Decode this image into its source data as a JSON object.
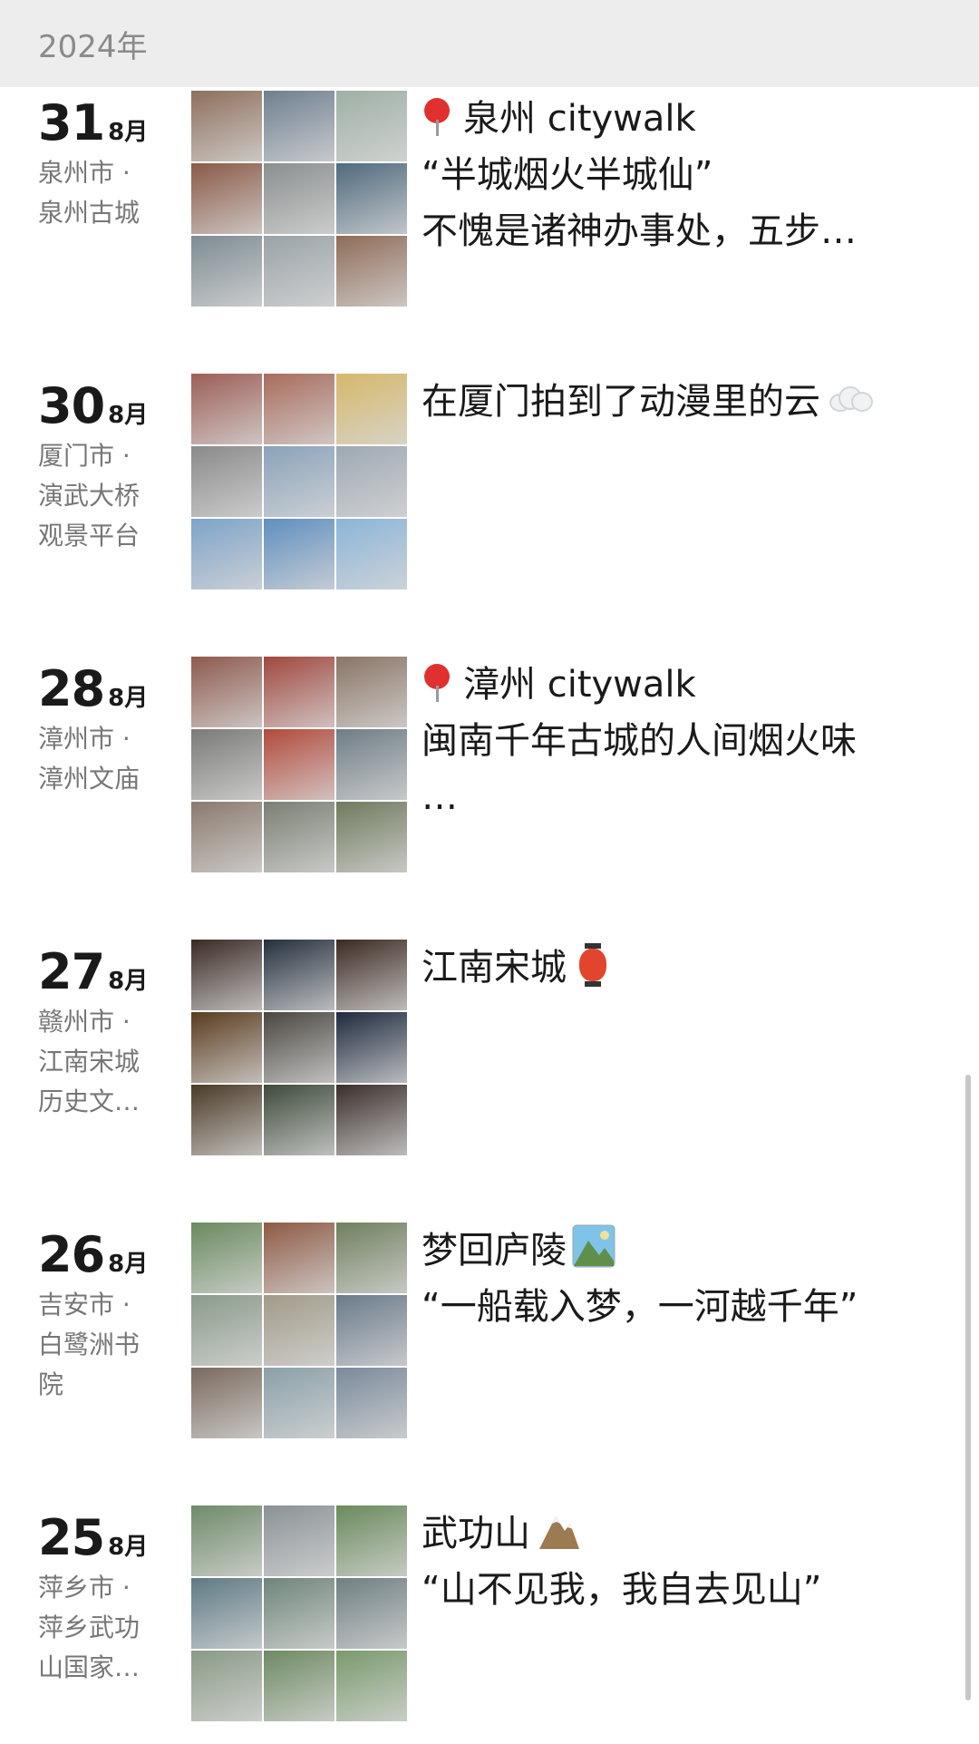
{
  "year": "2024年",
  "entries": [
    {
      "day": "31",
      "month": "8月",
      "location": "泉州市 ·\n泉州古城",
      "lines": [
        "泉州 citywalk",
        "“半城烟火半城仙”",
        "不愧是诸神办事处，五步…"
      ],
      "icon": "map-pin-icon",
      "tiles": [
        "#8e6f5c",
        "#6f7f90",
        "#9fb0a6",
        "#8a5a46",
        "#8b8f8f",
        "#4f6a7e",
        "#7e8c93",
        "#9aa3a8",
        "#8f6c58"
      ]
    },
    {
      "day": "30",
      "month": "8月",
      "location": "厦门市 ·\n演武大桥\n观景平台",
      "lines": [
        "在厦门拍到了动漫里的云"
      ],
      "icon": "cloud-icon",
      "tiles": [
        "#9c5e56",
        "#a86c5c",
        "#d6b86a",
        "#8a8a8a",
        "#8aa2ba",
        "#9ea9b3",
        "#7ea3c9",
        "#5f8fbf",
        "#8bb5d8"
      ]
    },
    {
      "day": "28",
      "month": "8月",
      "location": "漳州市 ·\n漳州文庙",
      "lines": [
        "漳州 citywalk",
        "闽南千年古城的人间烟火味",
        "…"
      ],
      "icon": "map-pin-icon",
      "tiles": [
        "#8e5a4e",
        "#a0483e",
        "#8a7566",
        "#7a7a78",
        "#b24a3c",
        "#6f7d86",
        "#8a7a6e",
        "#7a7f72",
        "#6f7a5e"
      ]
    },
    {
      "day": "27",
      "month": "8月",
      "location": "赣州市 ·\n江南宋城\n历史文…",
      "lines": [
        "江南宋城"
      ],
      "icon": "lantern-icon",
      "tiles": [
        "#3a2a24",
        "#25303e",
        "#3c2a22",
        "#5a3c1e",
        "#4a4640",
        "#1e2a3e",
        "#4a3a26",
        "#3e4a3a",
        "#3a2e2a"
      ]
    },
    {
      "day": "26",
      "month": "8月",
      "location": "吉安市 ·\n白鹭洲书\n院",
      "lines": [
        "梦回庐陵",
        "“一船载入梦，一河越千年”"
      ],
      "icon": "landscape-icon",
      "tiles": [
        "#6a8a5e",
        "#8e5a44",
        "#6f7f5e",
        "#8a9a8a",
        "#a09a88",
        "#6a7a8a",
        "#7a6a5e",
        "#8aa0a8",
        "#7a8a9a"
      ]
    },
    {
      "day": "25",
      "month": "8月",
      "location": "萍乡市 ·\n萍乡武功\n山国家…",
      "lines": [
        "武功山",
        "“山不见我，我自去见山”"
      ],
      "icon": "mountain-icon",
      "tiles": [
        "#6f8a6a",
        "#8a9296",
        "#6a8a5c",
        "#5e7a84",
        "#6f857a",
        "#6f7f82",
        "#8a9a86",
        "#6e8a62",
        "#7a9a6c"
      ]
    }
  ]
}
